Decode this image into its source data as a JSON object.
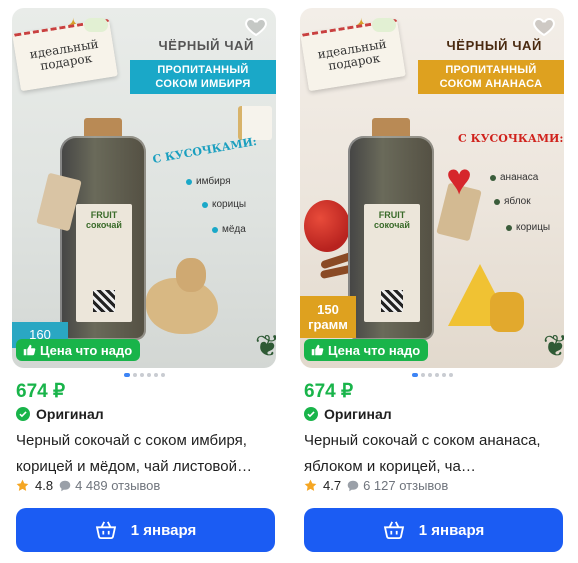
{
  "colors": {
    "accent_green": "#19b44a",
    "primary_blue": "#1b5cf3",
    "ginger_banner": "#1aa8c8",
    "pineapple_banner": "#dea11f",
    "dot_active": "#3d84f5"
  },
  "icons": [
    "heart-outline-icon",
    "like-icon",
    "check-circle-icon",
    "star-icon",
    "review-bubble-icon",
    "basket-icon"
  ],
  "products": [
    {
      "image": {
        "postcard_text": "идеальный подарок",
        "tea_type": "ЧЁРНЫЙ ЧАЙ",
        "flavor_line1": "ПРОПИТАННЫЙ",
        "flavor_line2": "СОКОМ ИМБИРЯ",
        "with_pieces": "С КУСОЧКАМИ:",
        "ingredients": [
          "имбиря",
          "корицы",
          "мёда"
        ],
        "jar_brand": "FRUIT сокочай",
        "weight_line1": "160",
        "weight_line2": ""
      },
      "price_badge": "Цена что надо",
      "carousel": {
        "count": 6,
        "active": 0
      },
      "price": "674 ₽",
      "original_label": "Оригинал",
      "title": "Черный сокочай с соком имбиря, корицей и мёдом, чай листовой…",
      "rating": "4.8",
      "reviews": "4 489 отзывов",
      "delivery": "1 января"
    },
    {
      "image": {
        "postcard_text": "идеальный подарок",
        "tea_type": "ЧЁРНЫЙ ЧАЙ",
        "flavor_line1": "ПРОПИТАННЫЙ",
        "flavor_line2": "СОКОМ АНАНАСА",
        "with_pieces": "С КУСОЧКАМИ:",
        "ingredients": [
          "ананаса",
          "яблок",
          "корицы"
        ],
        "jar_brand": "FRUIT сокочай",
        "weight_line1": "150",
        "weight_line2": "грамм"
      },
      "price_badge": "Цена что надо",
      "carousel": {
        "count": 6,
        "active": 0
      },
      "price": "674 ₽",
      "original_label": "Оригинал",
      "title": "Черный сокочай с соком ананаса, яблоком и корицей, ча…",
      "rating": "4.7",
      "reviews": "6 127 отзывов",
      "delivery": "1 января"
    }
  ]
}
